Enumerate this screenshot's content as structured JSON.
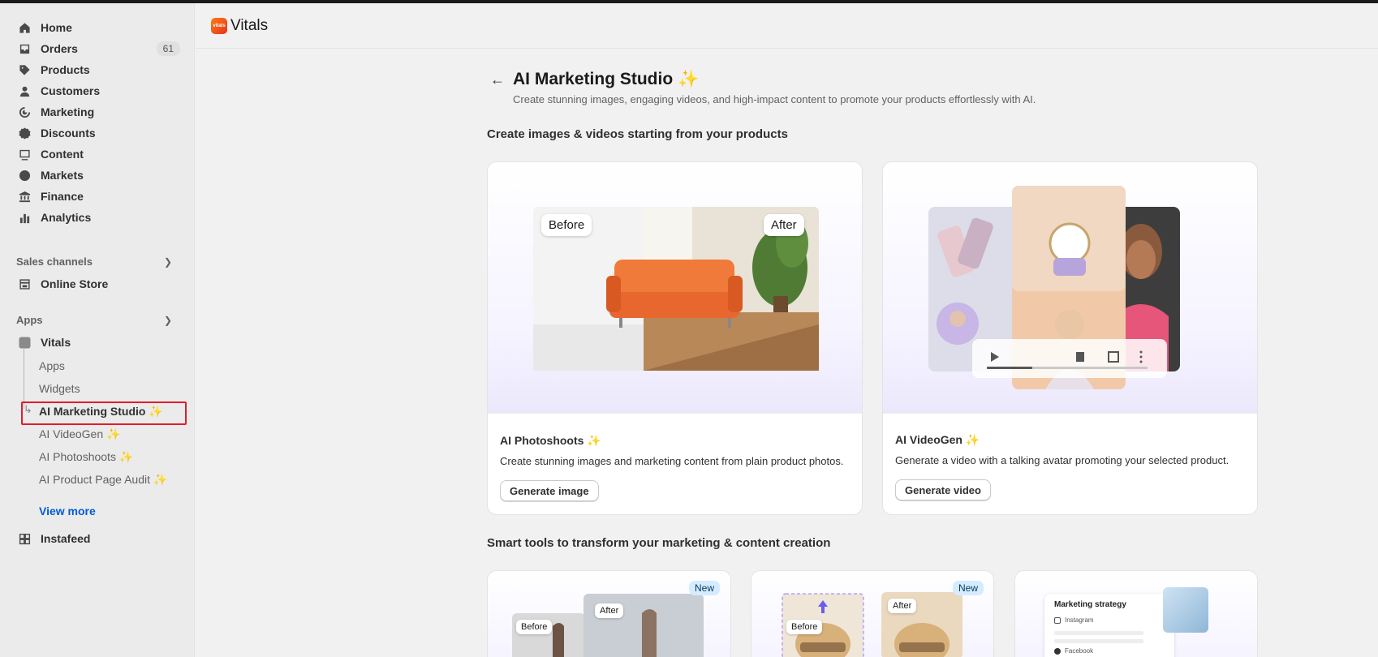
{
  "sidebar": {
    "nav": [
      {
        "label": "Home",
        "icon": "home-icon"
      },
      {
        "label": "Orders",
        "icon": "inbox-icon",
        "badge": "61"
      },
      {
        "label": "Products",
        "icon": "tag-icon"
      },
      {
        "label": "Customers",
        "icon": "person-icon"
      },
      {
        "label": "Marketing",
        "icon": "target-icon"
      },
      {
        "label": "Discounts",
        "icon": "discount-icon"
      },
      {
        "label": "Content",
        "icon": "content-icon"
      },
      {
        "label": "Markets",
        "icon": "globe-icon"
      },
      {
        "label": "Finance",
        "icon": "bank-icon"
      },
      {
        "label": "Analytics",
        "icon": "bar-chart-icon"
      }
    ],
    "sales_channels_label": "Sales channels",
    "online_store": "Online Store",
    "apps_label": "Apps",
    "vitals": "Vitals",
    "vitals_sub": [
      "Apps",
      "Widgets",
      "AI Marketing Studio ✨",
      "AI VideoGen ✨",
      "AI Photoshoots ✨",
      "AI Product Page Audit ✨"
    ],
    "view_more": "View more",
    "instafeed": "Instafeed"
  },
  "header": {
    "app_name": "Vitals",
    "logo_text": "vitals"
  },
  "main": {
    "title": "AI Marketing Studio ✨",
    "subtitle": "Create stunning images, engaging videos, and high-impact content to promote your products effortlessly with AI.",
    "section1": "Create images & videos starting from your products",
    "cards": [
      {
        "title": "AI Photoshoots ✨",
        "desc": "Create stunning images and marketing content from plain product photos.",
        "button": "Generate image",
        "before": "Before",
        "after": "After"
      },
      {
        "title": "AI VideoGen ✨",
        "desc": "Generate a video with a talking avatar promoting your selected product.",
        "button": "Generate video"
      }
    ],
    "section2": "Smart tools to transform your marketing & content creation",
    "tools": [
      {
        "badge": "New",
        "before": "Before",
        "after": "After"
      },
      {
        "badge": "New",
        "before": "Before",
        "after": "After"
      },
      {
        "heading": "Marketing strategy",
        "item1": "Instagram",
        "item2": "Facebook"
      }
    ]
  },
  "colors": {
    "accent": "#005bd3",
    "highlight": "#e11d2b",
    "badge_new": "#d5ebff"
  }
}
